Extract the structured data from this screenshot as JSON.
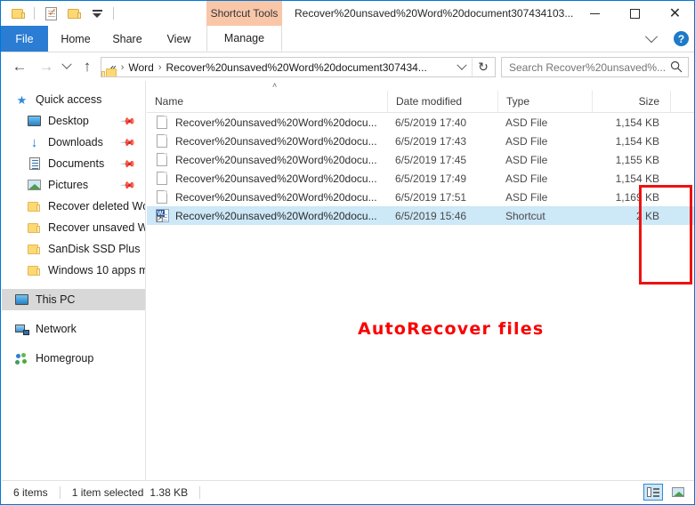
{
  "window": {
    "title": "Recover%20unsaved%20Word%20document307434103...",
    "contextual_tab": "Shortcut Tools",
    "minimize": "—",
    "maximize": "",
    "close": "✕"
  },
  "quick_access_toolbar": {
    "items": [
      "folder-icon",
      "properties-icon",
      "new-folder-icon",
      "customize-dropdown-icon"
    ]
  },
  "ribbon": {
    "tabs": [
      {
        "label": "File",
        "active": false
      },
      {
        "label": "Home",
        "active": false
      },
      {
        "label": "Share",
        "active": false
      },
      {
        "label": "View",
        "active": false
      },
      {
        "label": "Manage",
        "active": true
      }
    ],
    "expand_icon": "chevron-down-icon",
    "help_label": "?"
  },
  "navigation": {
    "back_glyph": "←",
    "forward_glyph": "→",
    "recent_icon": "chevron-down-icon",
    "up_glyph": "↑",
    "address": {
      "folder_icon": "folder-icon",
      "overflow": "«",
      "crumbs": [
        "Word",
        "Recover%20unsaved%20Word%20document307434..."
      ],
      "separator": "›",
      "dropdown_icon": "chevron-down-icon",
      "refresh_glyph": "↻"
    },
    "search": {
      "placeholder": "Search Recover%20unsaved%...",
      "value": "",
      "icon": "search-icon"
    }
  },
  "sidebar": {
    "items": [
      {
        "label": "Quick access",
        "icon": "star-icon",
        "indent": false,
        "pinned": false,
        "selected": false
      },
      {
        "label": "Desktop",
        "icon": "monitor-icon",
        "indent": true,
        "pinned": true,
        "selected": false
      },
      {
        "label": "Downloads",
        "icon": "download-arrow-icon",
        "indent": true,
        "pinned": true,
        "selected": false
      },
      {
        "label": "Documents",
        "icon": "document-icon",
        "indent": true,
        "pinned": true,
        "selected": false
      },
      {
        "label": "Pictures",
        "icon": "picture-icon",
        "indent": true,
        "pinned": true,
        "selected": false
      },
      {
        "label": "Recover deleted Wc",
        "icon": "folder-icon",
        "indent": true,
        "pinned": false,
        "selected": false
      },
      {
        "label": "Recover unsaved W",
        "icon": "folder-icon",
        "indent": true,
        "pinned": false,
        "selected": false
      },
      {
        "label": "SanDisk SSD Plus",
        "icon": "folder-icon",
        "indent": true,
        "pinned": false,
        "selected": false
      },
      {
        "label": "Windows 10 apps m",
        "icon": "folder-icon",
        "indent": true,
        "pinned": false,
        "selected": false
      },
      {
        "label": "This PC",
        "icon": "monitor-icon",
        "indent": false,
        "pinned": false,
        "selected": true
      },
      {
        "label": "Network",
        "icon": "network-icon",
        "indent": false,
        "pinned": false,
        "selected": false
      },
      {
        "label": "Homegroup",
        "icon": "homegroup-icon",
        "indent": false,
        "pinned": false,
        "selected": false
      }
    ]
  },
  "filelist": {
    "sort_indicator": "˄",
    "columns": [
      "Name",
      "Date modified",
      "Type",
      "Size"
    ],
    "rows": [
      {
        "name": "Recover%20unsaved%20Word%20docu...",
        "date": "6/5/2019 17:40",
        "type": "ASD File",
        "size": "1,154 KB",
        "icon": "blank-file-icon",
        "selected": false
      },
      {
        "name": "Recover%20unsaved%20Word%20docu...",
        "date": "6/5/2019 17:43",
        "type": "ASD File",
        "size": "1,154 KB",
        "icon": "blank-file-icon",
        "selected": false
      },
      {
        "name": "Recover%20unsaved%20Word%20docu...",
        "date": "6/5/2019 17:45",
        "type": "ASD File",
        "size": "1,155 KB",
        "icon": "blank-file-icon",
        "selected": false
      },
      {
        "name": "Recover%20unsaved%20Word%20docu...",
        "date": "6/5/2019 17:49",
        "type": "ASD File",
        "size": "1,154 KB",
        "icon": "blank-file-icon",
        "selected": false
      },
      {
        "name": "Recover%20unsaved%20Word%20docu...",
        "date": "6/5/2019 17:51",
        "type": "ASD File",
        "size": "1,169 KB",
        "icon": "blank-file-icon",
        "selected": false
      },
      {
        "name": "Recover%20unsaved%20Word%20docu...",
        "date": "6/5/2019 15:46",
        "type": "Shortcut",
        "size": "2 KB",
        "icon": "word-shortcut-icon",
        "selected": true
      }
    ]
  },
  "annotations": {
    "caption": "AutoRecover files",
    "highlight_color": "#ee1111",
    "caption_color": "#fa0000"
  },
  "statusbar": {
    "item_count": "6 items",
    "selection": "1 item selected",
    "selection_size": "1.38 KB",
    "view_details_icon": "details-view-icon",
    "view_icons_icon": "large-icons-view-icon"
  }
}
